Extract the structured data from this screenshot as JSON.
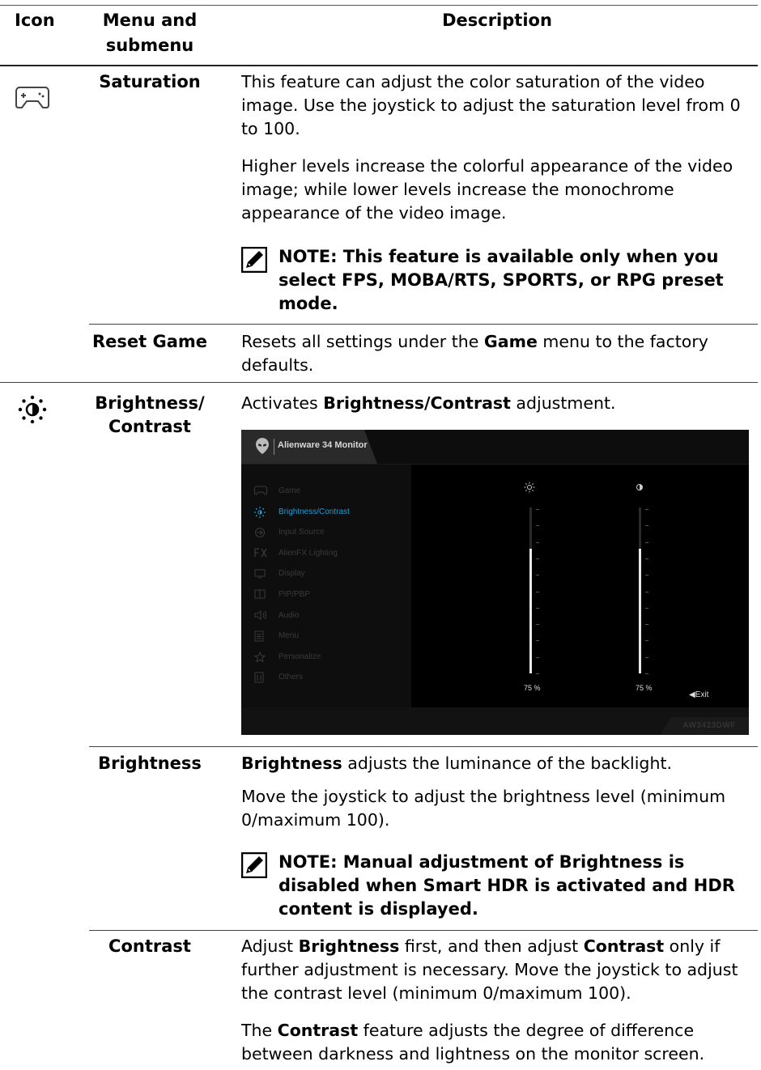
{
  "table": {
    "headers": {
      "icon": "Icon",
      "menu": "Menu and submenu",
      "description": "Description"
    }
  },
  "rows": {
    "saturation": {
      "submenu": "Saturation",
      "p1": "This feature can adjust the color saturation of the video image. Use the joystick to adjust the saturation level from 0 to 100.",
      "p2": "Higher levels increase the colorful appearance of the video image; while lower levels increase the monochrome appearance of the video image.",
      "note": "NOTE: This feature is available only when you select FPS, MOBA/RTS, SPORTS, or RPG preset mode."
    },
    "reset_game": {
      "submenu": "Reset Game",
      "t1": "Resets all settings under the ",
      "b1": "Game",
      "t2": " menu to the factory defaults."
    },
    "brightness_contrast": {
      "submenu_line1": "Brightness/",
      "submenu_line2": "Contrast",
      "t1": "Activates ",
      "b1": "Brightness/Contrast",
      "t2": " adjustment."
    },
    "brightness": {
      "submenu": "Brightness",
      "b1": "Brightness",
      "t1": " adjusts the luminance of the backlight.",
      "p2": "Move the joystick to adjust the brightness level (minimum 0/maximum 100).",
      "note": "NOTE: Manual adjustment of Brightness is disabled when Smart HDR is activated and HDR content is displayed."
    },
    "contrast": {
      "submenu": "Contrast",
      "t1": "Adjust ",
      "b1": "Brightness",
      "t2": " first, and then adjust ",
      "b2": "Contrast",
      "t3": " only if further adjustment is necessary. Move the joystick to adjust the contrast level (minimum 0/maximum 100).",
      "t4": "The ",
      "b3": "Contrast",
      "t5": " feature adjusts the degree of difference between darkness and lightness on the monitor screen."
    }
  },
  "osd": {
    "title": "Alienware 34 Monitor",
    "menu": [
      "Game",
      "Brightness/Contrast",
      "Input Source",
      "AlienFX Lighting",
      "Display",
      "PIP/PBP",
      "Audio",
      "Menu",
      "Personalize",
      "Others"
    ],
    "brightness_value": "75 %",
    "contrast_value": "75 %",
    "brightness_level": 0.75,
    "contrast_level": 0.75,
    "exit_label": "Exit",
    "model": "AW3423DWF",
    "accent_color": "#1e9bd8"
  }
}
